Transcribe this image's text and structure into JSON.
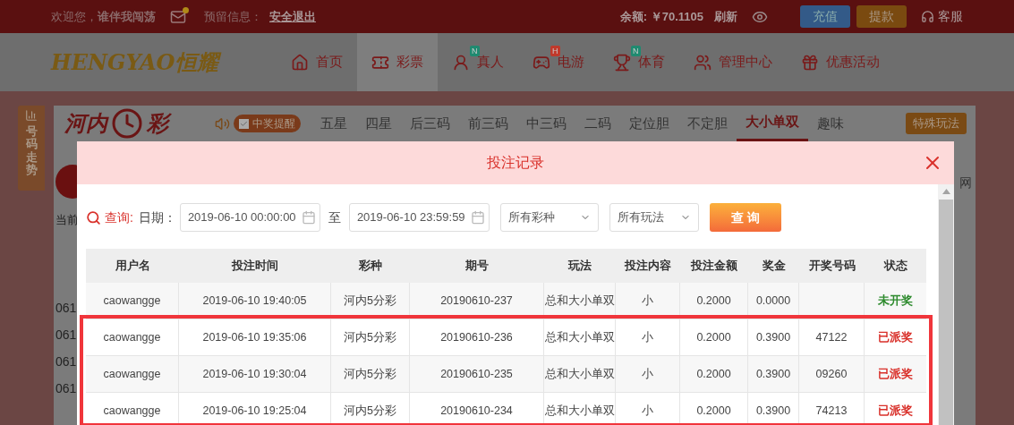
{
  "top_bar": {
    "welcome": "欢迎您，**谁伴我闯荡**",
    "mail_unread": true,
    "reserved_label": "预留信息：",
    "logout": "安全退出",
    "balance": "余额: ￥70.1105",
    "refresh": "刷新",
    "deposit": "充值",
    "withdraw": "提款",
    "service": "客服"
  },
  "nav": {
    "logo": "HENGYAO恒耀",
    "items": [
      {
        "kind": "home",
        "label": "首页",
        "selected": false
      },
      {
        "kind": "ticket",
        "label": "彩票",
        "selected": true
      },
      {
        "kind": "live",
        "label": "真人",
        "selected": false,
        "badge": {
          "text": "N",
          "color": "#1f8a70"
        }
      },
      {
        "kind": "game",
        "label": "电游",
        "selected": false,
        "badge": {
          "text": "H",
          "color": "#c0392b"
        }
      },
      {
        "kind": "sport",
        "label": "体育",
        "selected": false,
        "badge": {
          "text": "N",
          "color": "#1f8a70"
        }
      },
      {
        "kind": "manage",
        "label": "管理中心",
        "selected": false
      },
      {
        "kind": "gift",
        "label": "优惠活动",
        "selected": false
      }
    ]
  },
  "side_tab": "号码走势",
  "lottery": {
    "logo_left": "河内",
    "logo_right": "彩",
    "win_alert": {
      "label": "中奖提醒",
      "checked": true
    },
    "play_tabs": [
      {
        "label": "五星",
        "selected": false
      },
      {
        "label": "四星",
        "selected": false
      },
      {
        "label": "后三码",
        "selected": false
      },
      {
        "label": "前三码",
        "selected": false
      },
      {
        "label": "中三码",
        "selected": false
      },
      {
        "label": "二码",
        "selected": false
      },
      {
        "label": "定位胆",
        "selected": false
      },
      {
        "label": "不定胆",
        "selected": false
      },
      {
        "label": "大小单双",
        "selected": true
      },
      {
        "label": "趣味",
        "selected": false
      }
    ],
    "special": "特殊玩法",
    "current_label": "当前",
    "issue_prefixes": [
      "061",
      "061",
      "061",
      "061"
    ],
    "right_text": "网"
  },
  "modal": {
    "title": "投注记录",
    "query_label": "查询:",
    "date_label": "日期：",
    "date_from": "2019-06-10 00:00:00",
    "to_label": "至",
    "date_to": "2019-06-10 23:59:59",
    "lottery_select": "所有彩种",
    "play_select": "所有玩法",
    "query_button": "查 询",
    "table": {
      "columns": [
        "用户名",
        "投注时间",
        "彩种",
        "期号",
        "玩法",
        "投注内容",
        "投注金额",
        "奖金",
        "开奖号码",
        "状态"
      ],
      "rows": [
        {
          "cells": [
            "caowangge",
            "2019-06-10 19:40:05",
            "河内5分彩",
            "20190610-237",
            "总和大小单双",
            "小",
            "0.2000",
            "0.0000",
            ""
          ],
          "status": "未开奖",
          "color": "#2e8b2e",
          "highlighted": false
        },
        {
          "cells": [
            "caowangge",
            "2019-06-10 19:35:06",
            "河内5分彩",
            "20190610-236",
            "总和大小单双",
            "小",
            "0.2000",
            "0.3900",
            "47122"
          ],
          "status": "已派奖",
          "color": "#d9312b",
          "highlighted": true
        },
        {
          "cells": [
            "caowangge",
            "2019-06-10 19:30:04",
            "河内5分彩",
            "20190610-235",
            "总和大小单双",
            "小",
            "0.2000",
            "0.3900",
            "09260"
          ],
          "status": "已派奖",
          "color": "#d9312b",
          "highlighted": true
        },
        {
          "cells": [
            "caowangge",
            "2019-06-10 19:25:04",
            "河内5分彩",
            "20190610-234",
            "总和大小单双",
            "小",
            "0.2000",
            "0.3900",
            "74213"
          ],
          "status": "已派奖",
          "color": "#d9312b",
          "highlighted": true
        }
      ]
    }
  }
}
